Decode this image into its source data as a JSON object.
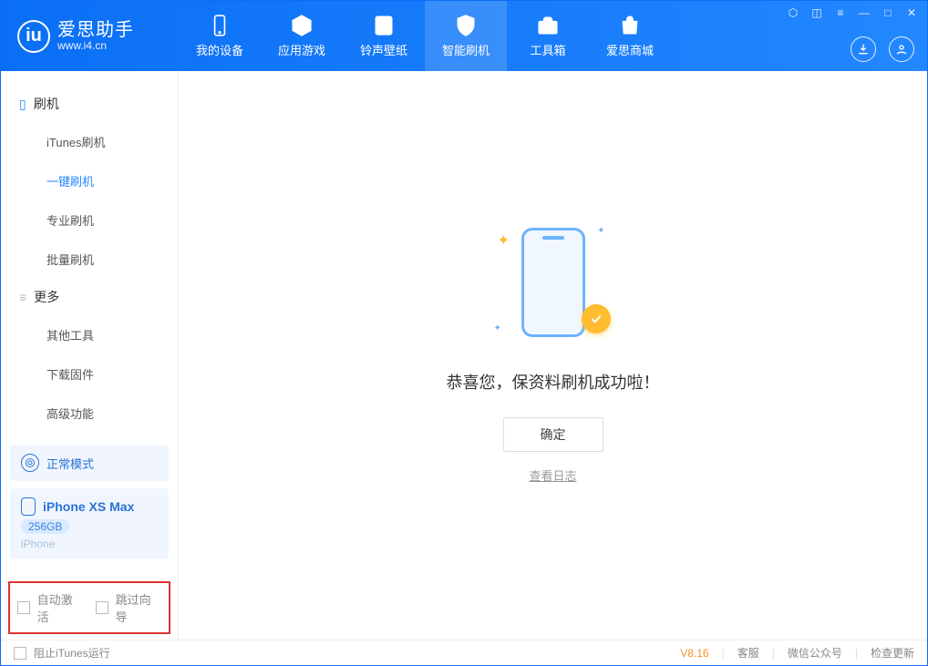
{
  "app": {
    "name_cn": "爱思助手",
    "url": "www.i4.cn"
  },
  "nav": [
    {
      "label": "我的设备",
      "active": false
    },
    {
      "label": "应用游戏",
      "active": false
    },
    {
      "label": "铃声壁纸",
      "active": false
    },
    {
      "label": "智能刷机",
      "active": true
    },
    {
      "label": "工具箱",
      "active": false
    },
    {
      "label": "爱思商城",
      "active": false
    }
  ],
  "sidebar": {
    "section1_title": "刷机",
    "section1_items": [
      {
        "label": "iTunes刷机"
      },
      {
        "label": "一键刷机",
        "active": true
      },
      {
        "label": "专业刷机"
      },
      {
        "label": "批量刷机"
      }
    ],
    "section2_title": "更多",
    "section2_items": [
      {
        "label": "其他工具"
      },
      {
        "label": "下载固件"
      },
      {
        "label": "高级功能"
      }
    ]
  },
  "mode": {
    "label": "正常模式"
  },
  "device": {
    "name": "iPhone XS Max",
    "capacity": "256GB",
    "type": "iPhone"
  },
  "options": {
    "auto_activate": "自动激活",
    "skip_guide": "跳过向导"
  },
  "main": {
    "success_text": "恭喜您，保资料刷机成功啦！",
    "confirm_label": "确定",
    "log_link": "查看日志"
  },
  "statusbar": {
    "block_itunes": "阻止iTunes运行",
    "version": "V8.16",
    "links": [
      "客服",
      "微信公众号",
      "检查更新"
    ]
  }
}
